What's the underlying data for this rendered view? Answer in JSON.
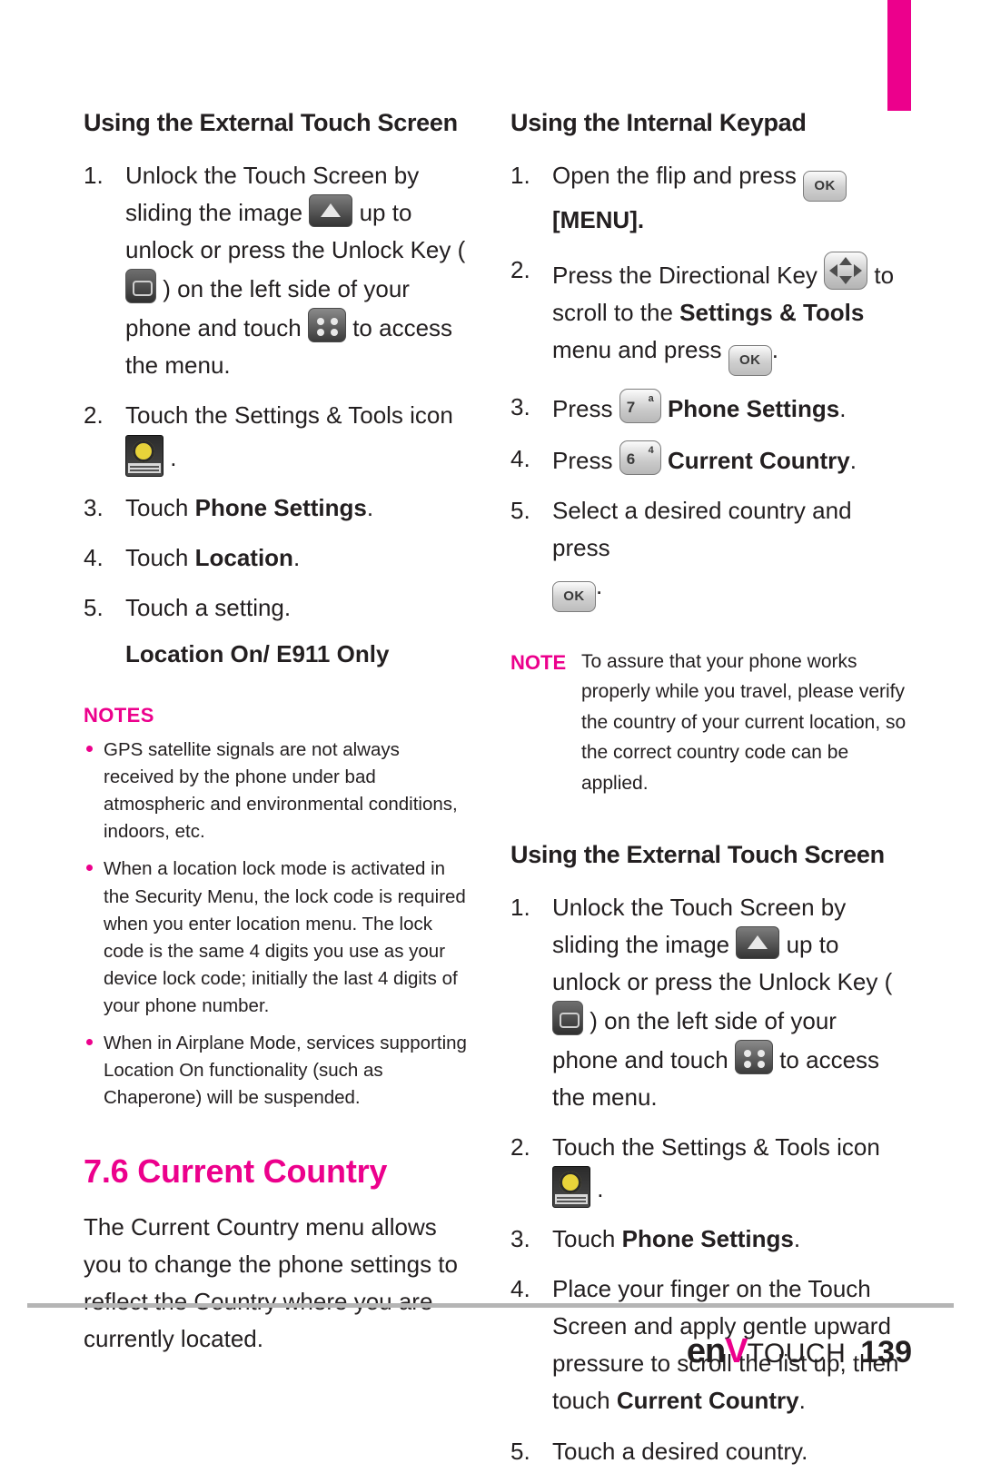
{
  "page": {
    "number": "139",
    "logo_pre": "en",
    "logo_v": "V",
    "logo_post": "TOUCH"
  },
  "left_column": {
    "heading": "Using the External Touch Screen",
    "steps": [
      {
        "num": "1.",
        "part1": "Unlock the Touch Screen by sliding the image",
        "part2": "up to unlock or press the Unlock Key (",
        "part3": ") on the left side of your phone and touch",
        "part4": "to access the menu."
      },
      {
        "num": "2.",
        "text": "Touch the Settings & Tools icon",
        "after": "."
      },
      {
        "num": "3.",
        "pre": "Touch ",
        "bold": "Phone Settings",
        "post": "."
      },
      {
        "num": "4.",
        "pre": "Touch ",
        "bold": "Location",
        "post": "."
      },
      {
        "num": "5.",
        "text": "Touch a setting."
      }
    ],
    "subheading": "Location On/ E911 Only",
    "notes_title": "NOTES",
    "notes": [
      "GPS satellite signals are not always received by the phone under bad atmospheric and environmental conditions, indoors, etc.",
      "When a location lock mode is activated in the Security Menu, the lock code is required when you enter location menu. The lock code is the same 4 digits you use as your device lock code; initially the last 4 digits of your phone number.",
      "When in Airplane Mode, services supporting Location On functionality (such as Chaperone) will be suspended."
    ],
    "chapter_title": "7.6 Current Country",
    "chapter_body": "The Current Country menu allows you to change the phone settings to reflect the Country where you are currently located."
  },
  "right_column": {
    "heading_1": "Using the Internal Keypad",
    "steps_1": [
      {
        "num": "1.",
        "pre": "Open the flip and press",
        "post": "",
        "bold_next": "[MENU]."
      },
      {
        "num": "2.",
        "pre": "Press the Directional Key",
        "mid": "to scroll to the ",
        "bold": "Settings & Tools",
        "post": " menu and press",
        "end": "."
      },
      {
        "num": "3.",
        "pre": "Press",
        "bold": "Phone Settings",
        "post": ".",
        "key_num": "7",
        "key_alt": "a"
      },
      {
        "num": "4.",
        "pre": "Press",
        "bold": "Current Country",
        "post": ".",
        "key_num": "6",
        "key_alt": "4"
      },
      {
        "num": "5.",
        "pre": "Select a desired country and press",
        "post": "."
      }
    ],
    "note_tag": "NOTE",
    "note_text": "To assure that your phone works properly while you travel, please verify the country of your current location, so the correct country code can be applied.",
    "heading_2": "Using the External Touch Screen",
    "steps_2": [
      {
        "num": "1.",
        "part1": "Unlock the Touch Screen by sliding the image",
        "part2": "up to unlock or press the Unlock Key (",
        "part3": ") on the left side of your phone and touch",
        "part4": "to access the menu."
      },
      {
        "num": "2.",
        "text": "Touch the Settings & Tools icon",
        "after": "."
      },
      {
        "num": "3.",
        "pre": "Touch ",
        "bold": "Phone Settings",
        "post": "."
      },
      {
        "num": "4.",
        "pre": "Place your finger on the Touch Screen and apply gentle upward pressure to scroll the list up, then touch ",
        "bold": "Current Country",
        "post": "."
      },
      {
        "num": "5.",
        "text": "Touch a desired country."
      }
    ]
  },
  "icons": {
    "ok_key": "OK",
    "arrow_up_key": "arrow-up-key",
    "unlock_key": "unlock-key",
    "menu_dots_key": "menu-dots-key",
    "directional_key": "directional-key",
    "settings_tools_icon": "settings-tools-icon"
  },
  "colors": {
    "accent": "#ec008c",
    "text": "#231f20",
    "rule": "#b5b5b5"
  }
}
